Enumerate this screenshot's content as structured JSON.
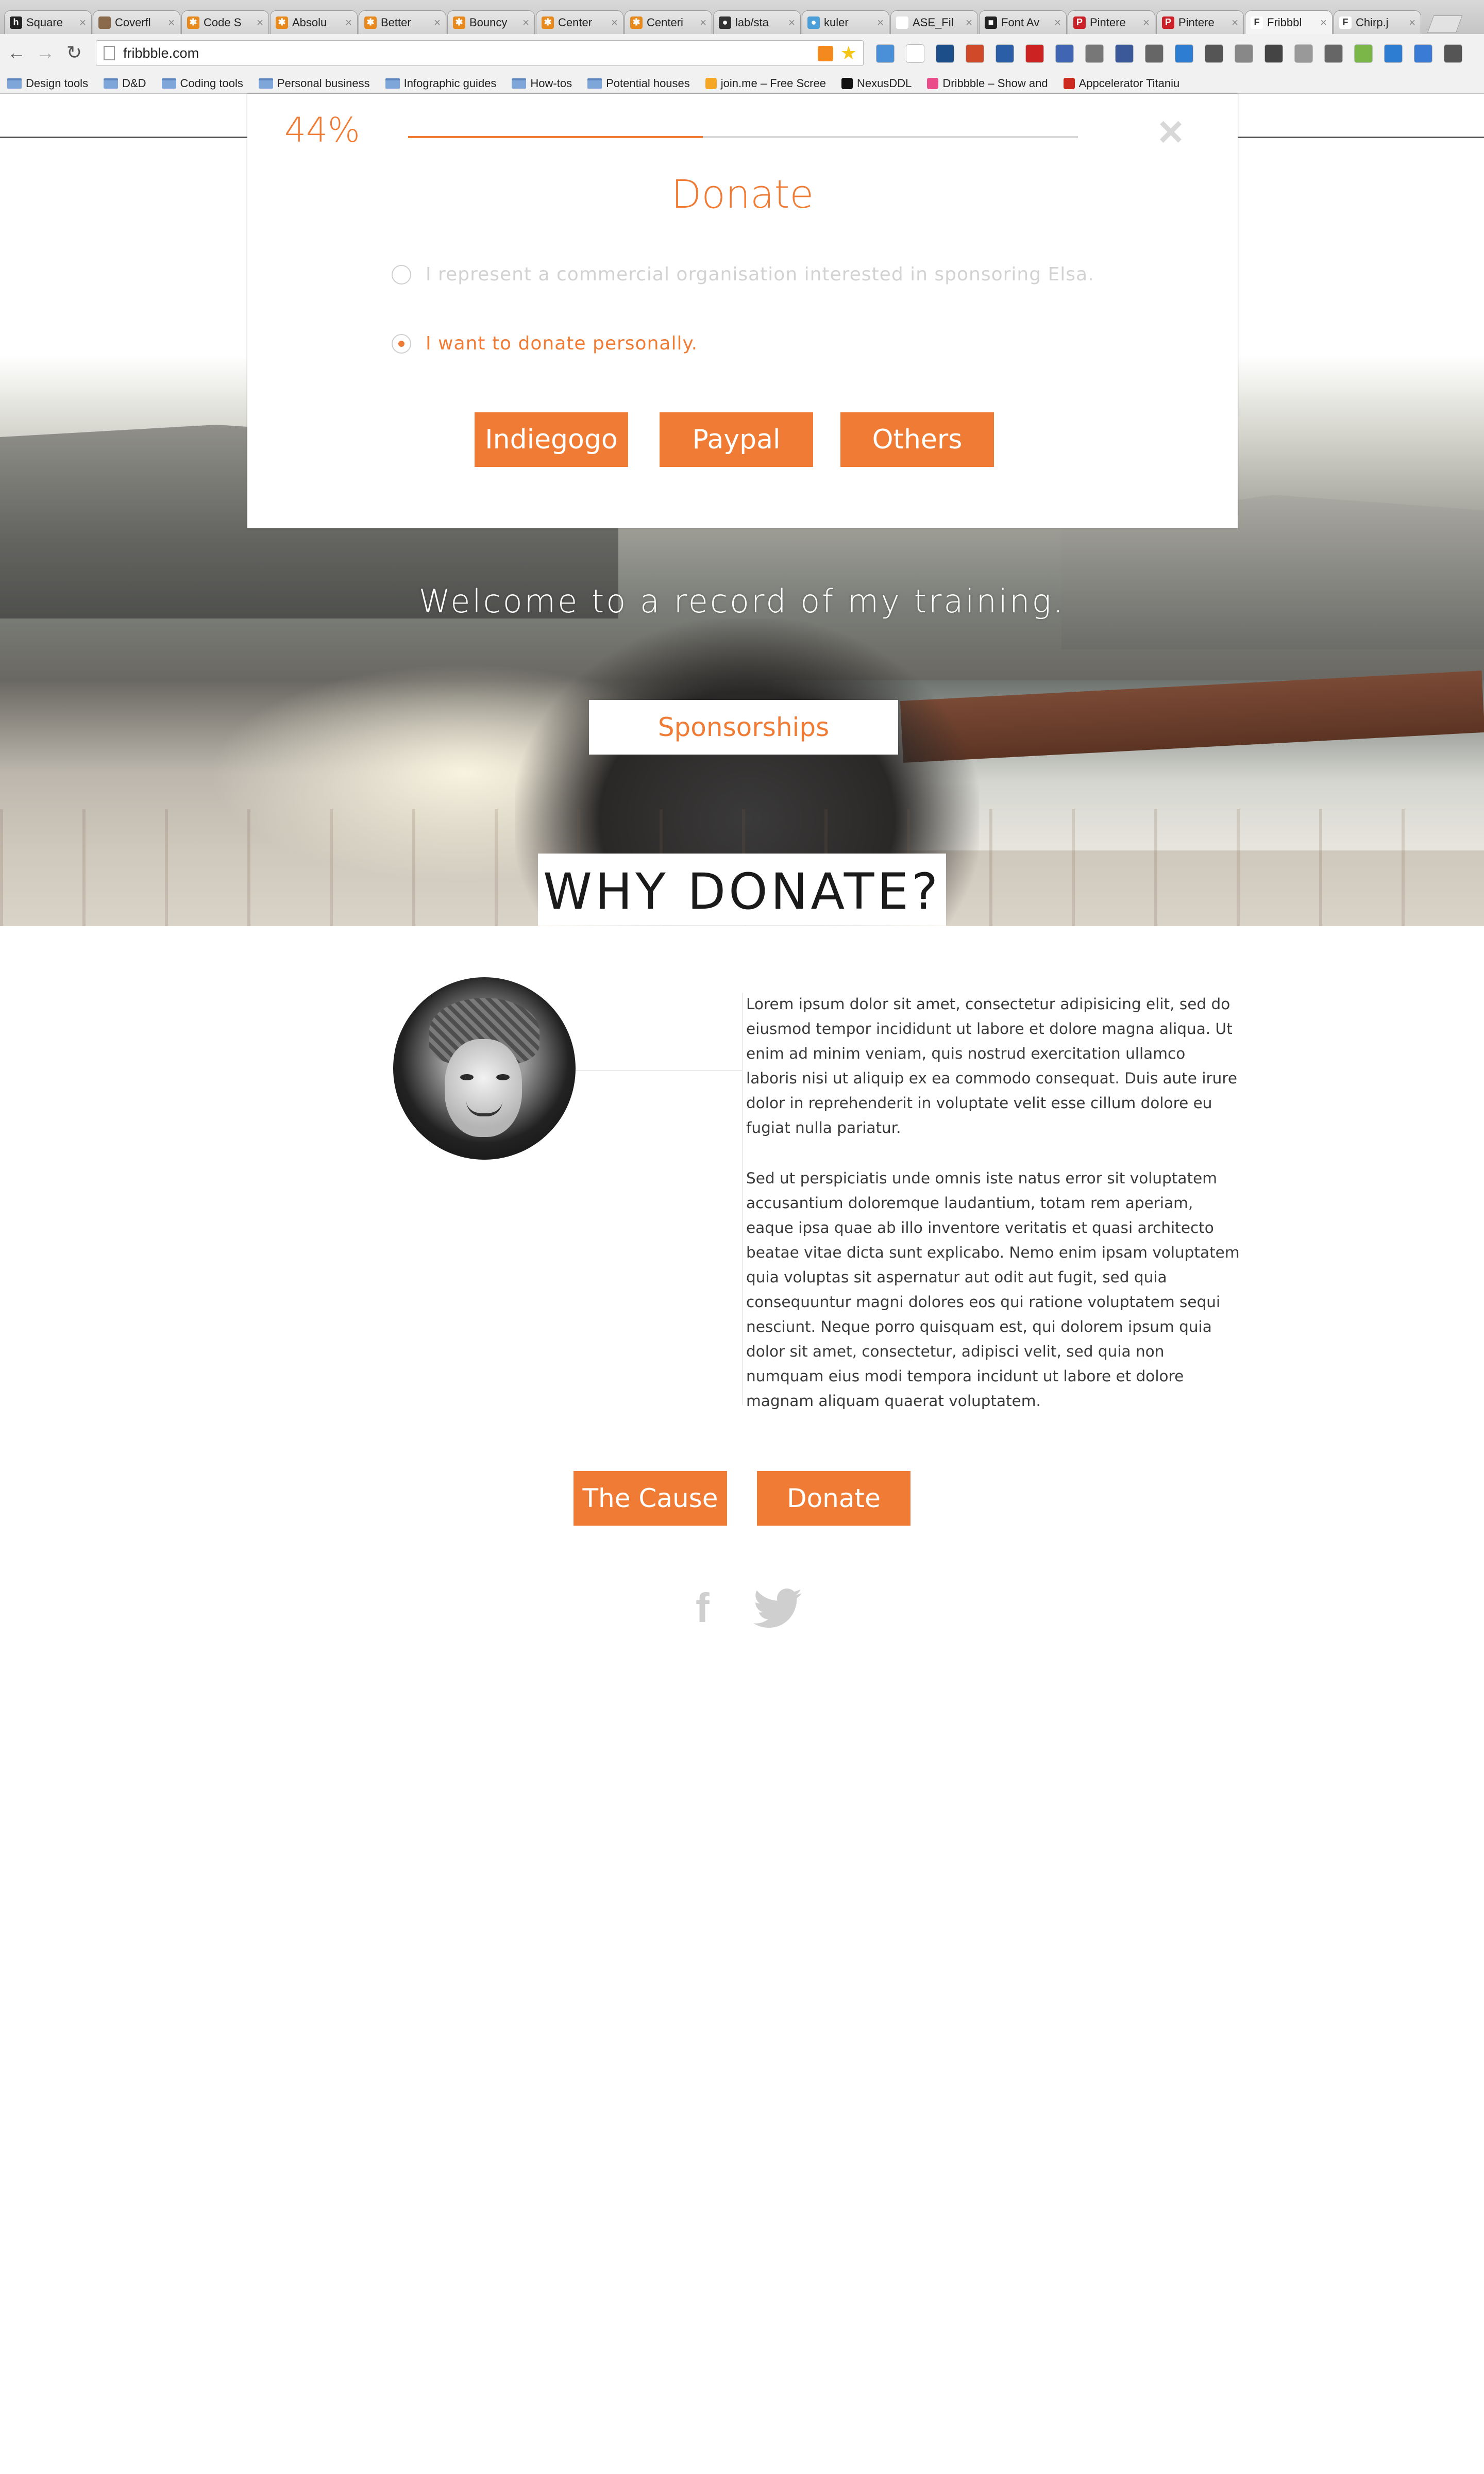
{
  "browser": {
    "tabs": [
      {
        "label": "Square",
        "color": "#222222",
        "glyph": "h"
      },
      {
        "label": "Coverfl",
        "color": "#8a6a4a",
        "glyph": ""
      },
      {
        "label": "Code S",
        "color": "#e8891e",
        "glyph": "✱"
      },
      {
        "label": "Absolu",
        "color": "#e8891e",
        "glyph": "✱"
      },
      {
        "label": "Better",
        "color": "#e8891e",
        "glyph": "✱"
      },
      {
        "label": "Bouncy",
        "color": "#e8891e",
        "glyph": "✱"
      },
      {
        "label": "Center",
        "color": "#e8891e",
        "glyph": "✱"
      },
      {
        "label": "Centeri",
        "color": "#e8891e",
        "glyph": "✱"
      },
      {
        "label": "lab/sta",
        "color": "#333333",
        "glyph": "●"
      },
      {
        "label": "kuler",
        "color": "#4a9fd8",
        "glyph": "●"
      },
      {
        "label": "ASE_Fil",
        "color": "#ffffff",
        "glyph": ""
      },
      {
        "label": "Font Av",
        "color": "#222222",
        "glyph": "■"
      },
      {
        "label": "Pintere",
        "color": "#cb2027",
        "glyph": "P"
      },
      {
        "label": "Pintere",
        "color": "#cb2027",
        "glyph": "P"
      },
      {
        "label": "Fribbbl",
        "color": "#ffffff",
        "glyph": "F",
        "active": true
      },
      {
        "label": "Chirp.j",
        "color": "#ffffff",
        "glyph": "F"
      }
    ],
    "tab_close": "×",
    "nav": {
      "back": "←",
      "forward": "→",
      "reload": "↻"
    },
    "url": "fribbble.com",
    "bookmarks": [
      {
        "label": "Design tools",
        "kind": "folder"
      },
      {
        "label": "D&D",
        "kind": "folder"
      },
      {
        "label": "Coding tools",
        "kind": "folder"
      },
      {
        "label": "Personal business",
        "kind": "folder"
      },
      {
        "label": "Infographic guides",
        "kind": "folder"
      },
      {
        "label": "How-tos",
        "kind": "folder"
      },
      {
        "label": "Potential houses",
        "kind": "folder"
      },
      {
        "label": "join.me – Free Scree",
        "kind": "link",
        "color": "#f5a623"
      },
      {
        "label": "NexusDDL",
        "kind": "link",
        "color": "#111111"
      },
      {
        "label": "Dribbble – Show and",
        "kind": "link",
        "color": "#ea4c89"
      },
      {
        "label": "Appcelerator Titaniu",
        "kind": "link",
        "color": "#cc2a1f"
      }
    ]
  },
  "modal": {
    "progress_text": "44%",
    "progress_value": 0.44,
    "close_glyph": "×",
    "title": "Donate",
    "options": [
      {
        "label": "I represent a commercial organisation interested in sponsoring Elsa.",
        "selected": false
      },
      {
        "label": "I want to donate personally.",
        "selected": true
      }
    ],
    "buttons": [
      "Indiegogo",
      "Paypal",
      "Others"
    ]
  },
  "hero": {
    "welcome": "Welcome to a record of my training.",
    "sponsor_button": "Sponsorships"
  },
  "why": {
    "title": "WHY DONATE?",
    "paragraphs": [
      "Lorem ipsum dolor sit amet, consectetur adipisicing elit, sed do eiusmod tempor incididunt ut labore et dolore magna aliqua. Ut enim ad minim veniam, quis nostrud exercitation ullamco laboris nisi ut aliquip ex ea commodo consequat. Duis aute irure dolor in reprehenderit in voluptate velit esse cillum dolore eu fugiat nulla pariatur.",
      "Sed ut perspiciatis unde omnis iste natus error sit voluptatem accusantium doloremque laudantium, totam rem aperiam, eaque ipsa quae ab illo inventore veritatis et quasi architecto beatae vitae dicta sunt explicabo. Nemo enim ipsam voluptatem quia voluptas sit aspernatur aut odit aut fugit, sed quia consequuntur magni dolores eos qui ratione voluptatem sequi nesciunt. Neque porro quisquam est, qui dolorem ipsum quia dolor sit amet, consectetur, adipisci velit, sed quia non numquam eius modi tempora incidunt ut labore et dolore magnam aliquam quaerat voluptatem."
    ],
    "buttons": {
      "cause": "The Cause",
      "donate": "Donate"
    }
  },
  "social": {
    "facebook_glyph": "f"
  },
  "colors": {
    "accent": "#f07b35",
    "text": "#3a3a3a",
    "muted": "#d2d2d2"
  }
}
